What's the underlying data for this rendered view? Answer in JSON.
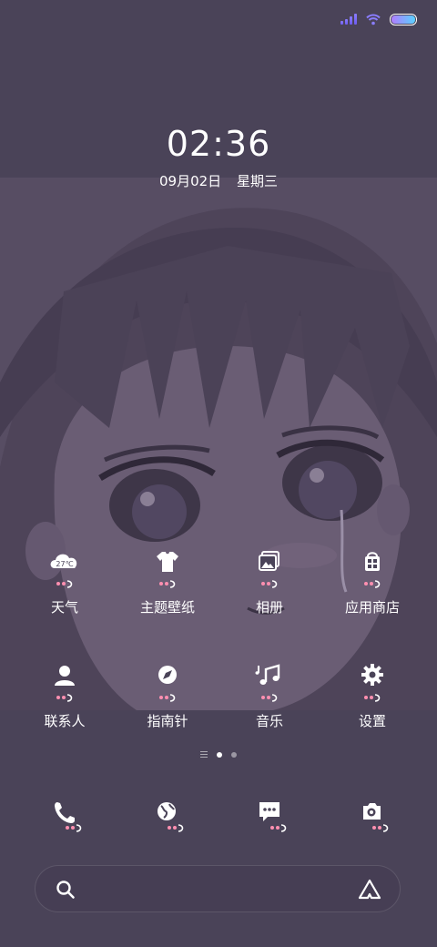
{
  "status_bar": {
    "icons": [
      "signal-icon",
      "wifi-icon",
      "battery-icon"
    ],
    "accent": "#8a7dff"
  },
  "clock": {
    "time": "02:36",
    "date": "09月02日",
    "weekday": "星期三"
  },
  "apps": [
    {
      "label": "天气",
      "icon": "weather-icon",
      "temp": "27℃"
    },
    {
      "label": "主题壁纸",
      "icon": "tshirt-icon"
    },
    {
      "label": "相册",
      "icon": "gallery-icon"
    },
    {
      "label": "应用商店",
      "icon": "app-store-icon"
    },
    {
      "label": "联系人",
      "icon": "contacts-icon"
    },
    {
      "label": "指南针",
      "icon": "compass-icon"
    },
    {
      "label": "音乐",
      "icon": "music-icon"
    },
    {
      "label": "设置",
      "icon": "settings-icon"
    }
  ],
  "pager": {
    "pages": 2,
    "active": 0
  },
  "dock": [
    {
      "icon": "phone-icon"
    },
    {
      "icon": "browser-icon"
    },
    {
      "icon": "messages-icon"
    },
    {
      "icon": "camera-icon"
    }
  ],
  "search": {
    "icon": "search-icon",
    "assistant_icon": "assistant-icon"
  },
  "colors": {
    "background": "#4a4358",
    "badge_pink": "#ff8fb0"
  }
}
